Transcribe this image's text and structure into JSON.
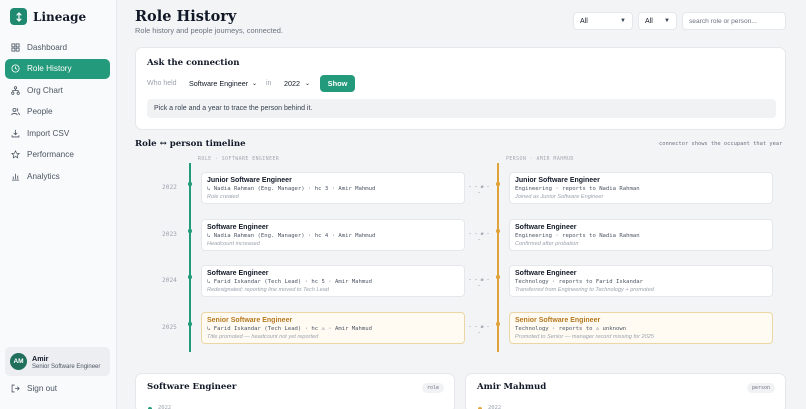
{
  "brand": {
    "name": "Lineage",
    "logo_icon": "lineage-logo-icon",
    "accent": "#239a7b"
  },
  "nav": [
    {
      "label": "Dashboard",
      "icon": "grid-icon",
      "active": false
    },
    {
      "label": "Role History",
      "icon": "clock-icon",
      "active": true
    },
    {
      "label": "Org Chart",
      "icon": "org-chart-icon",
      "active": false
    },
    {
      "label": "People",
      "icon": "people-icon",
      "active": false
    },
    {
      "label": "Import CSV",
      "icon": "download-icon",
      "active": false
    },
    {
      "label": "Performance",
      "icon": "star-icon",
      "active": false
    },
    {
      "label": "Analytics",
      "icon": "bar-chart-icon",
      "active": false
    }
  ],
  "user": {
    "initials": "AM",
    "name": "Amir",
    "role": "Senior Software Engineer"
  },
  "signout_label": "Sign out",
  "header": {
    "title": "Role History",
    "subtitle": "Role history and people journeys, connected.",
    "filter1": "All",
    "filter2": "All",
    "search_placeholder": "search role or person..."
  },
  "connection": {
    "title": "Ask the connection",
    "who_label": "Who held",
    "role_value": "Software Engineer",
    "in_label": "in",
    "year_value": "2022",
    "show_label": "Show",
    "hint": "Pick a role and a year to trace the person behind it."
  },
  "timeline": {
    "title": "Role ↔ person timeline",
    "note": "connector shows the occupant that year",
    "left_header": "ROLE · SOFTWARE ENGINEER",
    "right_header": "PERSON · AMIR MAHMUD",
    "role_color": "#239a7b",
    "person_color": "#e0a33a",
    "rows": [
      {
        "year": "2022",
        "connector": "- - ⇄ - -",
        "highlight": false,
        "left": {
          "title": "Junior Software Engineer",
          "meta": "↳ Nadia Rahman (Eng. Manager) · hc 3 · Amir Mahmud",
          "note": "Role created"
        },
        "right": {
          "title": "Junior Software Engineer",
          "meta": "Engineering · reports to Nadia Rahman",
          "note": "Joined as Junior Software Engineer"
        }
      },
      {
        "year": "2023",
        "connector": "- - ⇄ - -",
        "highlight": false,
        "left": {
          "title": "Software Engineer",
          "meta": "↳ Nadia Rahman (Eng. Manager) · hc 4 · Amir Mahmud",
          "note": "Headcount increased"
        },
        "right": {
          "title": "Software Engineer",
          "meta": "Engineering · reports to Nadia Rahman",
          "note": "Confirmed after probation"
        }
      },
      {
        "year": "2024",
        "connector": "- - ⇄ - -",
        "highlight": false,
        "left": {
          "title": "Software Engineer",
          "meta": "↳ Farid Iskandar (Tech Lead) · hc 5 · Amir Mahmud",
          "note": "Redesignated; reporting line moved to Tech Lead"
        },
        "right": {
          "title": "Software Engineer",
          "meta": "Technology · reports to Farid Iskandar",
          "note": "Transferred from Engineering to Technology + promoted"
        }
      },
      {
        "year": "2025",
        "connector": "- - ⇄ - -",
        "highlight": true,
        "left": {
          "title": "Senior Software Engineer",
          "meta": "↳ Farid Iskandar (Tech Lead) · hc ⚠ · Amir Mahmud",
          "note": "Title promoted — headcount not yet reported"
        },
        "right": {
          "title": "Senior Software Engineer",
          "meta": "Technology · reports to ⚠ unknown",
          "note": "Promoted to Senior — manager record missing for 2025"
        }
      }
    ]
  },
  "bottom": {
    "role_card": {
      "title": "Software Engineer",
      "badge": "role",
      "first_year": "2022"
    },
    "person_card": {
      "title": "Amir Mahmud",
      "badge": "person",
      "first_year": "2022"
    }
  }
}
